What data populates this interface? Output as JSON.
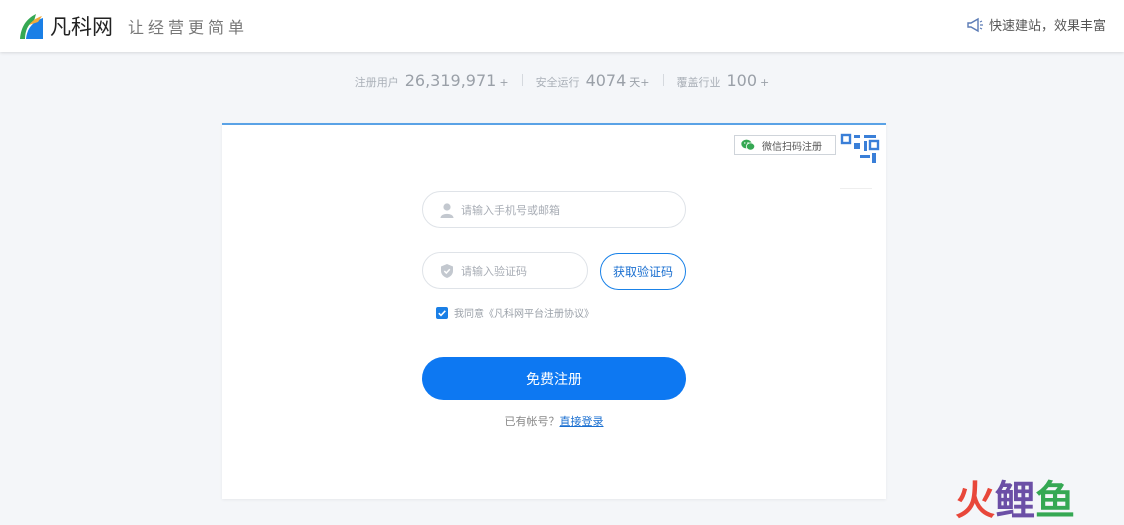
{
  "header": {
    "logo_text": "凡科网",
    "slogan": "让经营更简单",
    "right_text": "快速建站，效果丰富",
    "right_icon": "megaphone-icon"
  },
  "stats": [
    {
      "label": "注册用户",
      "value": "26,319,971",
      "suffix": "+"
    },
    {
      "label": "安全运行",
      "value": "4074",
      "suffix": "天+"
    },
    {
      "label": "覆盖行业",
      "value": "100",
      "suffix": "+"
    }
  ],
  "form": {
    "wechat_tag": "微信扫码注册",
    "phone_placeholder": "请输入手机号或邮箱",
    "phone_value": "",
    "code_placeholder": "请输入验证码",
    "code_value": "",
    "get_code_label": "获取验证码",
    "agree_text": "我同意《凡科网平台注册协议》",
    "agree_checked": true,
    "submit_label": "免费注册",
    "have_account_text": "已有帐号？",
    "login_link": "直接登录"
  },
  "watermark": {
    "chars": [
      "火",
      "鲤",
      "鱼"
    ]
  },
  "colors": {
    "accent": "#0d78f2",
    "link": "#1a6fd0",
    "card_top_border": "#5aa2e6",
    "watermark_red": "#e8473a",
    "watermark_purple": "#6b4fa6",
    "watermark_green": "#35a853"
  }
}
